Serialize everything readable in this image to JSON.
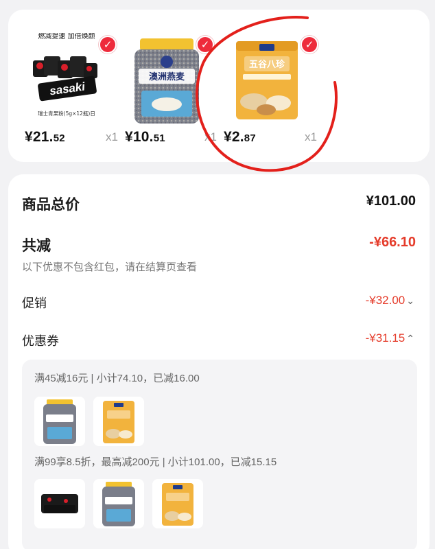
{
  "products": [
    {
      "brand_text": "sasaki",
      "top_text": "燃减提速 加倍焕颜",
      "caption": "瑞士青果粉(5g×12瓶)日",
      "price_main": "¥21.",
      "price_cents": "52",
      "qty": "x1",
      "checked": true
    },
    {
      "brand_text": "澳洲燕麦",
      "caption": "",
      "price_main": "¥10.",
      "price_cents": "51",
      "qty": "x1",
      "checked": true
    },
    {
      "brand_text": "五谷八珍",
      "caption": "",
      "price_main": "¥2.",
      "price_cents": "87",
      "qty": "x1",
      "checked": true
    }
  ],
  "summary": {
    "total_label": "商品总价",
    "total_value": "¥101.00",
    "reduce_label": "共减",
    "reduce_value": "-¥66.10",
    "note": "以下优惠不包含红包，请在结算页查看",
    "promo_label": "促销",
    "promo_value": "-¥32.00",
    "coupon_label": "优惠券",
    "coupon_value": "-¥31.15"
  },
  "coupons": [
    {
      "rule": "满45减16元 | 小计74.10，已减16.00"
    },
    {
      "rule": "满99享8.5折，最高减200元 | 小计101.00，已减15.15"
    }
  ],
  "icons": {
    "check": "✓",
    "chevron_down": "⌄",
    "chevron_up": "⌃"
  },
  "colors": {
    "accent_red": "#ee2b3b",
    "discount_red": "#e53b2a"
  }
}
